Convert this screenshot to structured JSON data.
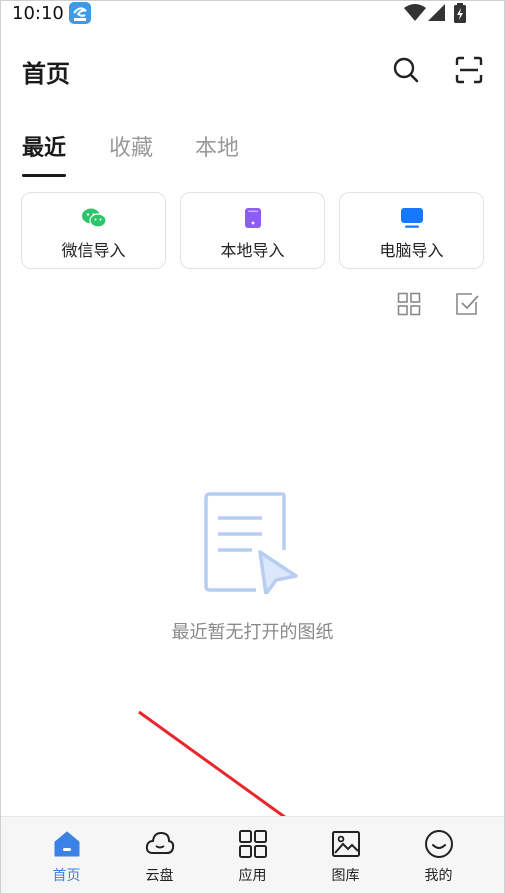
{
  "status_bar": {
    "time": "10:10"
  },
  "header": {
    "title": "首页"
  },
  "tabs": [
    {
      "label": "最近",
      "active": true
    },
    {
      "label": "收藏",
      "active": false
    },
    {
      "label": "本地",
      "active": false
    }
  ],
  "import_buttons": [
    {
      "label": "微信导入",
      "icon": "wechat-icon",
      "color": "#2ec46a"
    },
    {
      "label": "本地导入",
      "icon": "phone-icon",
      "color": "#8c5cf5"
    },
    {
      "label": "电脑导入",
      "icon": "monitor-icon",
      "color": "#1677ff"
    }
  ],
  "empty_state": {
    "message": "最近暂无打开的图纸"
  },
  "bottom_nav": [
    {
      "label": "首页",
      "icon": "home-icon",
      "active": true
    },
    {
      "label": "云盘",
      "icon": "cloud-icon",
      "active": false
    },
    {
      "label": "应用",
      "icon": "apps-grid-icon",
      "active": false
    },
    {
      "label": "图库",
      "icon": "gallery-icon",
      "active": false
    },
    {
      "label": "我的",
      "icon": "smile-face-icon",
      "active": false
    }
  ],
  "colors": {
    "accent": "#3b82e6",
    "annotation_arrow": "#e8262b"
  }
}
